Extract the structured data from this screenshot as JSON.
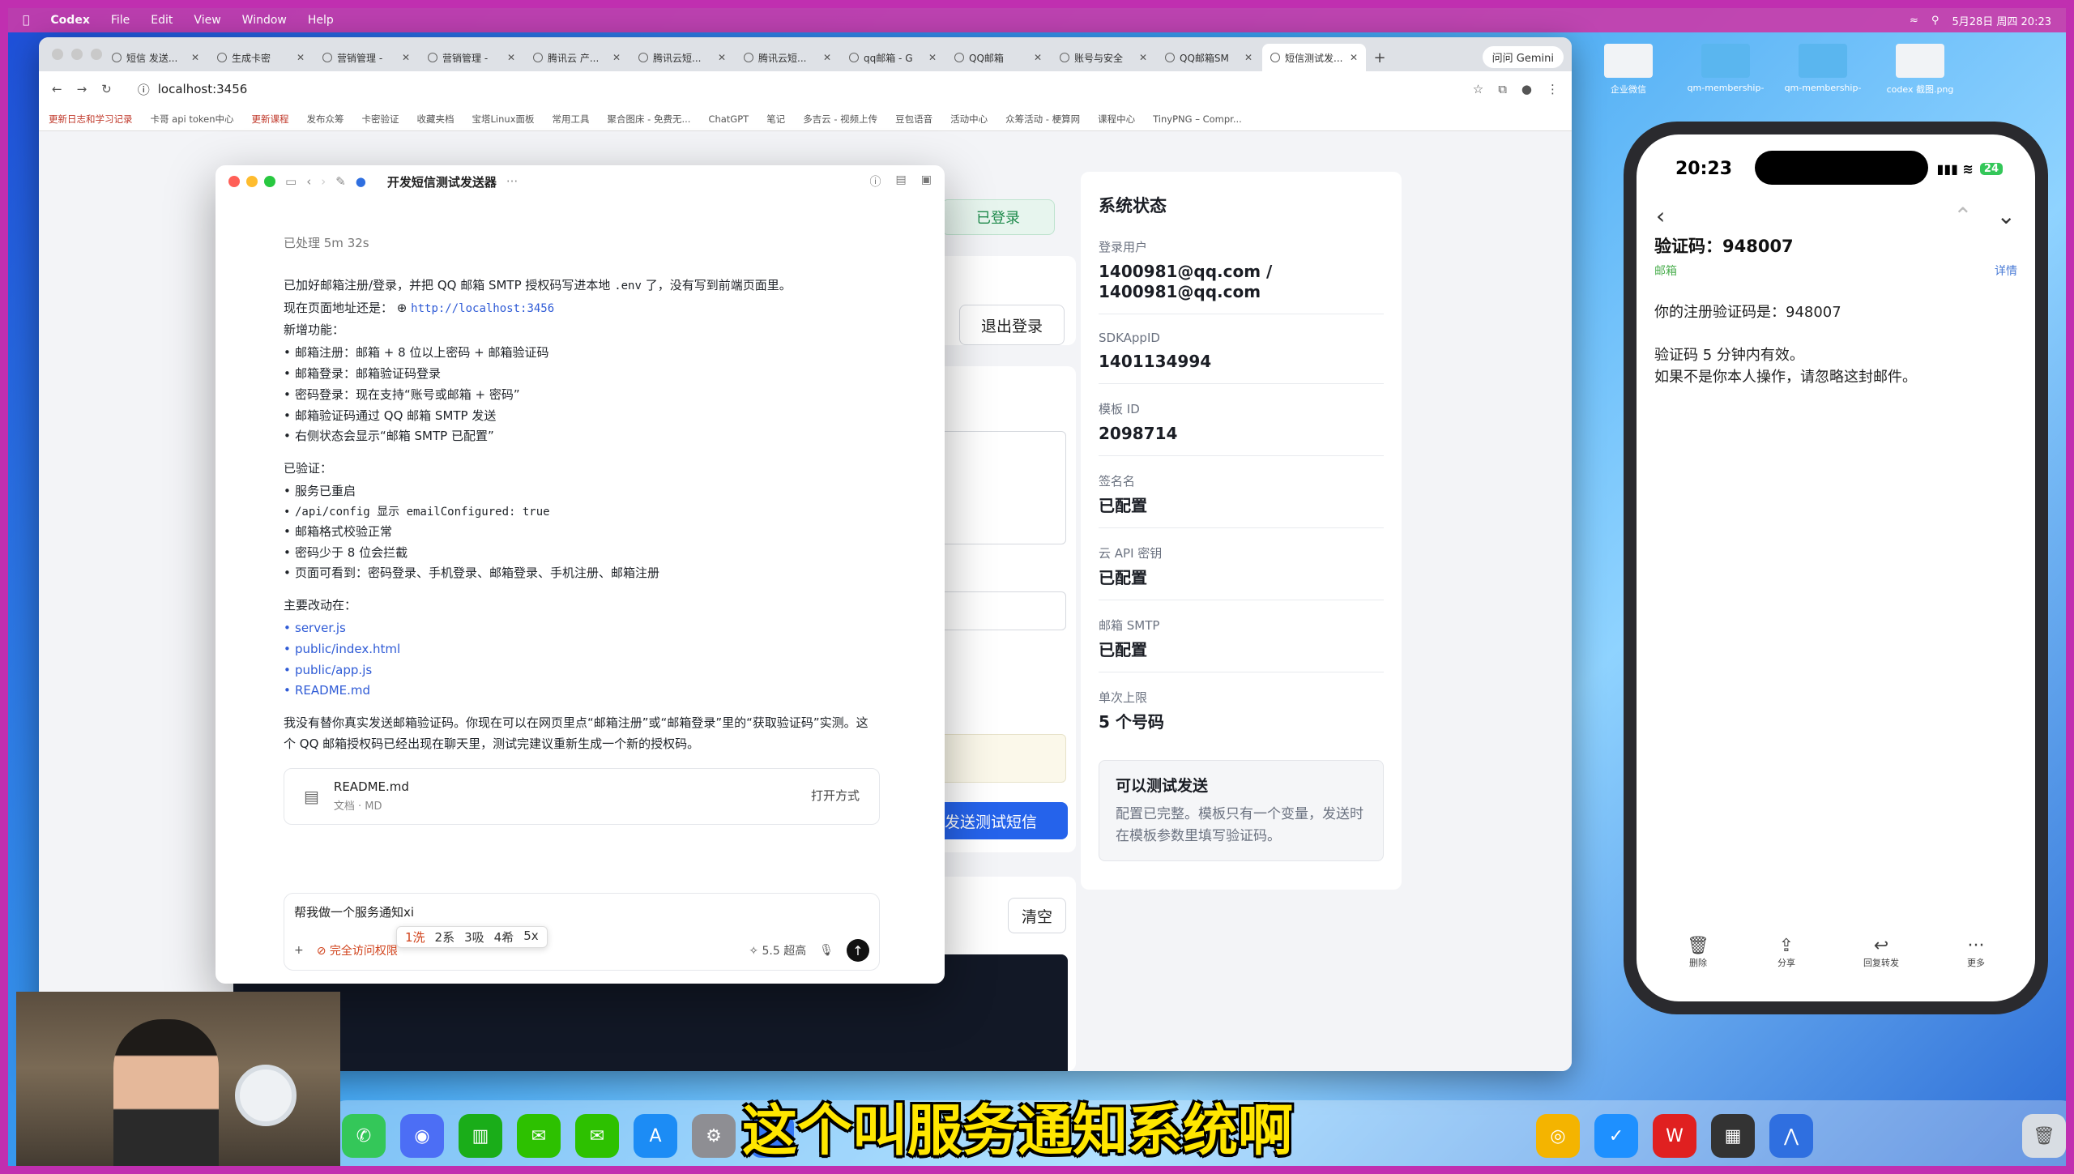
{
  "menubar": {
    "app": "Codex",
    "items": [
      "File",
      "Edit",
      "View",
      "Window",
      "Help"
    ],
    "date_time": "5月28日 周四 20:23"
  },
  "browser": {
    "tabs": [
      "短信 发送...",
      "生成卡密",
      "营销管理 -",
      "营销管理 -",
      "腾讯云 产...",
      "腾讯云短...",
      "腾讯云短...",
      "qq邮箱 - G",
      "QQ邮箱",
      "账号与安全",
      "QQ邮箱SM",
      "短信测试发..."
    ],
    "gemini": "问问 Gemini",
    "url": "localhost:3456",
    "bookmarks": [
      "更新日志和学习记录",
      "卡哥 api token中心",
      "更新课程",
      "发布众筹",
      "卡密验证",
      "收藏夹档",
      "宝塔Linux面板",
      "常用工具",
      "聚合图床 - 免费无...",
      "ChatGPT",
      "笔记",
      "多吉云 - 视频上传",
      "豆包语音",
      "活动中心",
      "众筹活动 - 梗算网",
      "课程中心",
      "TinyPNG – Compr..."
    ]
  },
  "page": {
    "logged_in": "已登录",
    "logout": "退出登录",
    "send_sms": "发送测试短信",
    "clear": "清空",
    "status": {
      "title": "系统状态",
      "items": [
        {
          "label": "登录用户",
          "value": "1400981@qq.com / 1400981@qq.com"
        },
        {
          "label": "SDKAppID",
          "value": "1401134994"
        },
        {
          "label": "模板 ID",
          "value": "2098714"
        },
        {
          "label": "签名名",
          "value": "已配置"
        },
        {
          "label": "云 API 密钥",
          "value": "已配置"
        },
        {
          "label": "邮箱 SMTP",
          "value": "已配置"
        },
        {
          "label": "单次上限",
          "value": "5 个号码"
        }
      ],
      "notice_title": "可以测试发送",
      "notice_desc": "配置已完整。模板只有一个变量，发送时在模板参数里填写验证码。"
    }
  },
  "codex": {
    "title": "开发短信测试发送器",
    "processed": "已处理 5m 32s",
    "p1a": "已加好邮箱注册/登录，并把 QQ 邮箱 SMTP 授权码写进本地",
    "p1code": ".env",
    "p1b": "了，没有写到前端页面里。",
    "p2a": "现在页面地址还是：",
    "p2link": "http://localhost:3456",
    "new_features": "新增功能：",
    "features": [
      "邮箱注册：邮箱 + 8 位以上密码 + 邮箱验证码",
      "邮箱登录：邮箱验证码登录",
      "密码登录：现在支持“账号或邮箱 + 密码”",
      "邮箱验证码通过 QQ 邮箱 SMTP 发送",
      "右侧状态会显示“邮箱 SMTP 已配置”"
    ],
    "verified": "已验证：",
    "checks": [
      "服务已重启",
      "/api/config 显示 emailConfigured: true",
      "邮箱格式校验正常",
      "密码少于 8 位会拦截",
      "页面可看到：密码登录、手机登录、邮箱登录、手机注册、邮箱注册"
    ],
    "changes": "主要改动在：",
    "files": [
      "server.js",
      "public/index.html",
      "public/app.js",
      "README.md"
    ],
    "note": "我没有替你真实发送邮箱验证码。你现在可以在网页里点“邮箱注册”或“邮箱登录”里的“获取验证码”实测。这个 QQ 邮箱授权码已经出现在聊天里，测试完建议重新生成一个新的授权码。",
    "file_card": {
      "name": "README.md",
      "sub": "文档 · MD",
      "open": "打开方式"
    },
    "composer": {
      "input": "帮我做一个服务通知xi",
      "ime": [
        "1洗",
        "2系",
        "3吸",
        "4希",
        "5x"
      ],
      "access": "完全访问权限",
      "model": "5.5 超高"
    }
  },
  "phone": {
    "time": "20:23",
    "battery": "24",
    "subject": "验证码：948007",
    "tag": "邮箱",
    "detail": "详情",
    "body1": "你的注册验证码是：948007",
    "body2": "验证码 5 分钟内有效。",
    "body3": "如果不是你本人操作，请忽略这封邮件。",
    "toolbar": [
      "删除",
      "分享",
      "回复转发",
      "更多"
    ]
  },
  "desktop": {
    "icons": [
      "企业微信",
      "qm-membership-",
      "qm-membership-",
      "codex 截图.png"
    ]
  },
  "subtitle": "这个叫服务通知系统啊"
}
